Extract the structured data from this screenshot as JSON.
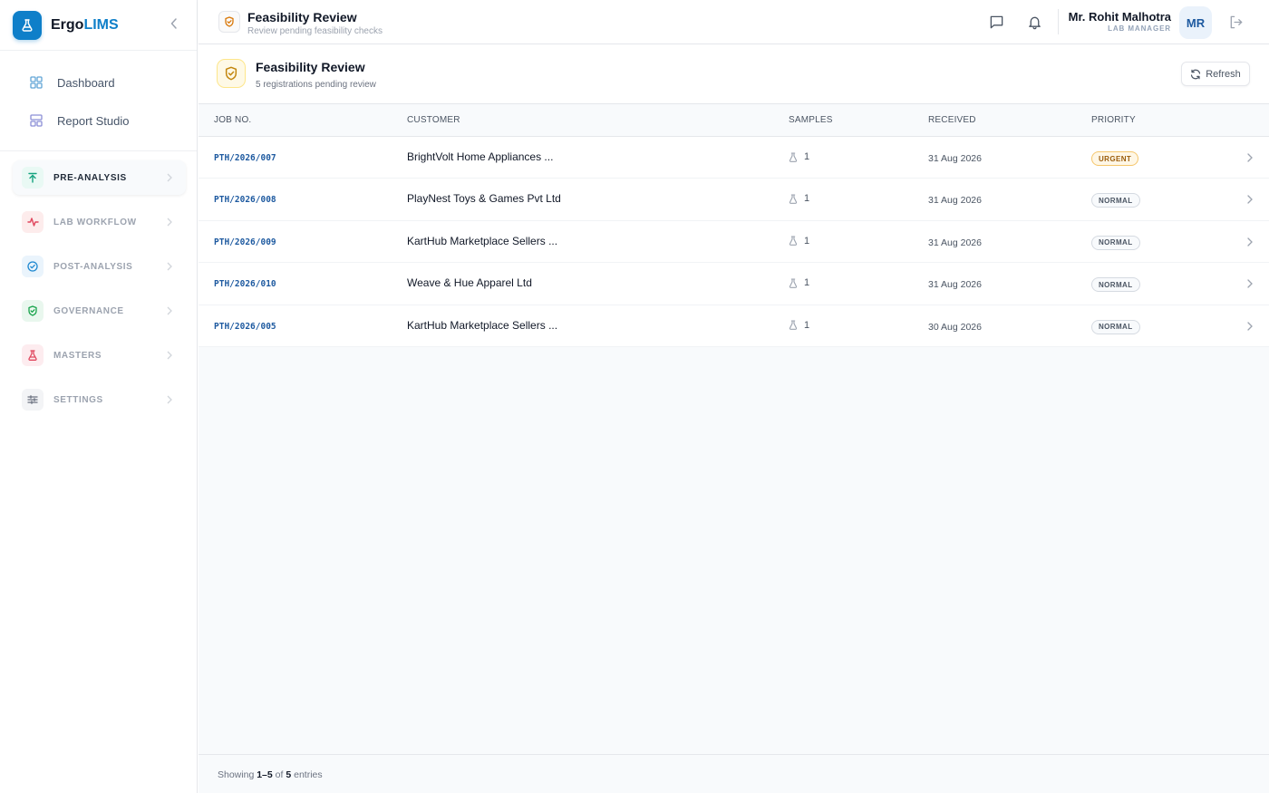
{
  "brand": {
    "name_prefix": "Ergo",
    "name_accent": "LIMS"
  },
  "sidebar": {
    "links": [
      {
        "label": "Dashboard",
        "icon": "grid-icon"
      },
      {
        "label": "Report Studio",
        "icon": "layout-icon"
      }
    ],
    "groups": [
      {
        "label": "PRE-ANALYSIS",
        "icon": "arrow-up-icon",
        "active": true
      },
      {
        "label": "LAB WORKFLOW",
        "icon": "activity-icon"
      },
      {
        "label": "POST-ANALYSIS",
        "icon": "check-circle-icon"
      },
      {
        "label": "GOVERNANCE",
        "icon": "shield-check-icon"
      },
      {
        "label": "MASTERS",
        "icon": "flask-icon"
      },
      {
        "label": "SETTINGS",
        "icon": "sliders-icon"
      }
    ]
  },
  "header": {
    "title": "Feasibility Review",
    "subtitle": "Review pending feasibility checks",
    "user_name": "Mr. Rohit Malhotra",
    "user_role": "LAB MANAGER",
    "avatar_initials": "MR"
  },
  "panel": {
    "title": "Feasibility Review",
    "subtitle": "5 registrations pending review",
    "refresh_label": "Refresh"
  },
  "table": {
    "columns": [
      "JOB NO.",
      "CUSTOMER",
      "SAMPLES",
      "RECEIVED",
      "PRIORITY"
    ],
    "rows": [
      {
        "job": "PTH/2026/007",
        "customer": "BrightVolt Home Appliances ...",
        "samples": "1",
        "received": "31 Aug 2026",
        "priority": "URGENT"
      },
      {
        "job": "PTH/2026/008",
        "customer": "PlayNest Toys & Games Pvt Ltd",
        "samples": "1",
        "received": "31 Aug 2026",
        "priority": "NORMAL"
      },
      {
        "job": "PTH/2026/009",
        "customer": "KartHub Marketplace Sellers ...",
        "samples": "1",
        "received": "31 Aug 2026",
        "priority": "NORMAL"
      },
      {
        "job": "PTH/2026/010",
        "customer": "Weave & Hue Apparel Ltd",
        "samples": "1",
        "received": "31 Aug 2026",
        "priority": "NORMAL"
      },
      {
        "job": "PTH/2026/005",
        "customer": "KartHub Marketplace Sellers ...",
        "samples": "1",
        "received": "30 Aug 2026",
        "priority": "NORMAL"
      }
    ]
  },
  "footer": {
    "prefix": "Showing",
    "range": "1–5",
    "of": "of",
    "total": "5",
    "suffix": "entries"
  },
  "colors": {
    "brand": "#0e7fc9",
    "link": "#1e5aa0",
    "urgent": "#9a5b09"
  }
}
